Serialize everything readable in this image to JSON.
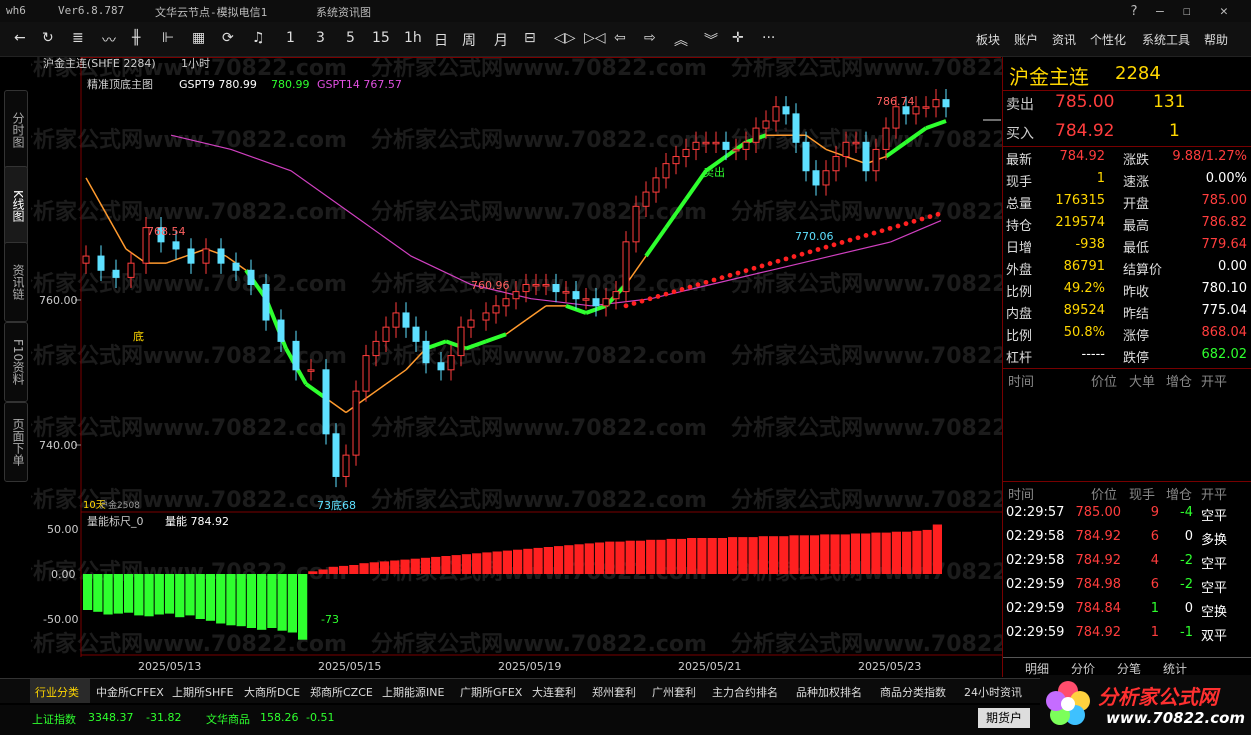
{
  "titlebar": {
    "app": "wh6",
    "version": "Ver6.8.787",
    "node": "文华云节点-模拟电信1",
    "news": "系统资讯图"
  },
  "toolbar": {
    "periods": [
      "1",
      "3",
      "5",
      "15",
      "1h",
      "日",
      "周",
      "月"
    ],
    "menus": [
      "板块",
      "账户",
      "资讯",
      "个性化",
      "系统工具",
      "帮助"
    ]
  },
  "left_tabs": [
    "分时图",
    "K线图",
    "资讯链",
    "F10资料",
    "页面下单"
  ],
  "chart": {
    "contract_label": "沪金主连(SHFE 2284)",
    "period": "1小时",
    "indicator_name": "精准顶底主图",
    "gsp9_label": "GSPT9 780.99",
    "gsp9_val": "780.99",
    "gsp14_label": "GSPT14 767.57",
    "price_ticks": [
      "760.00",
      "740.00"
    ],
    "annotations": {
      "high1": "768.54",
      "bottom1": "底",
      "high2": "760.96",
      "low_point": "73底68",
      "sell": "卖出",
      "low2": "770.06",
      "high3": "786.74",
      "days": "10天",
      "contract_code": "沪金2508"
    },
    "sub_indicator": "量能标尺_0",
    "sub_value": "量能 784.92",
    "sub_ticks": [
      "50.00",
      "0.00",
      "-50.00"
    ],
    "sub_min_label": "-73",
    "dates": [
      "2025/05/13",
      "2025/05/15",
      "2025/05/19",
      "2025/05/21",
      "2025/05/23"
    ],
    "watermark": "分析家公式网www.70822.com"
  },
  "chart_data": {
    "type": "candlestick",
    "title": "沪金主连(SHFE 2284)",
    "ylim": [
      728,
      792
    ],
    "volume_series": [
      -40,
      -42,
      -45,
      -44,
      -43,
      -46,
      -47,
      -45,
      -44,
      -48,
      -46,
      -50,
      -52,
      -55,
      -57,
      -58,
      -60,
      -62,
      -60,
      -63,
      -65,
      -73,
      3,
      5,
      8,
      9,
      10,
      12,
      13,
      14,
      15,
      16,
      17,
      18,
      19,
      20,
      21,
      22,
      23,
      24,
      25,
      26,
      27,
      28,
      29,
      30,
      31,
      32,
      33,
      34,
      35,
      36,
      36,
      37,
      37,
      38,
      38,
      39,
      39,
      40,
      40,
      40,
      40,
      41,
      41,
      41,
      42,
      42,
      42,
      43,
      43,
      43,
      44,
      44,
      44,
      45,
      45,
      46,
      46,
      47,
      47,
      48,
      49,
      55
    ]
  },
  "quote": {
    "name": "沪金主连",
    "code": "2284",
    "sell_label": "卖出",
    "sell_price": "785.00",
    "sell_qty": "131",
    "buy_label": "买入",
    "buy_price": "784.92",
    "buy_qty": "1",
    "rows": [
      [
        "最新",
        "784.92",
        "涨跌",
        "9.88/1.27%"
      ],
      [
        "现手",
        "1",
        "速涨",
        "0.00%"
      ],
      [
        "总量",
        "176315",
        "开盘",
        "785.00"
      ],
      [
        "持仓",
        "219574",
        "最高",
        "786.82"
      ],
      [
        "日增",
        "-938",
        "最低",
        "779.64"
      ],
      [
        "外盘",
        "86791",
        "结算价",
        "0.00"
      ],
      [
        "比例",
        "49.2%",
        "昨收",
        "780.10"
      ],
      [
        "内盘",
        "89524",
        "昨结",
        "775.04"
      ],
      [
        "比例",
        "50.8%",
        "涨停",
        "868.04"
      ],
      [
        "杠杆",
        "-----",
        "跌停",
        "682.02"
      ]
    ],
    "tick_header1": [
      "时间",
      "价位",
      "大单",
      "增仓",
      "开平"
    ],
    "tick_header2": [
      "时间",
      "价位",
      "现手",
      "增仓",
      "开平"
    ],
    "ticks": [
      [
        "02:29:57",
        "785.00",
        "9",
        "-4",
        "空平"
      ],
      [
        "02:29:58",
        "784.92",
        "6",
        "0",
        "多换"
      ],
      [
        "02:29:58",
        "784.92",
        "4",
        "-2",
        "空平"
      ],
      [
        "02:29:59",
        "784.98",
        "6",
        "-2",
        "空平"
      ],
      [
        "02:29:59",
        "784.84",
        "1",
        "0",
        "空换"
      ],
      [
        "02:29:59",
        "784.92",
        "1",
        "-1",
        "双平"
      ]
    ],
    "bottom_tabs": [
      "明细",
      "分价",
      "分笔",
      "统计"
    ]
  },
  "bottombar": {
    "items": [
      "行业分类",
      "中金所CFFEX",
      "上期所SHFE",
      "大商所DCE",
      "郑商所CZCE",
      "上期能源INE",
      "广期所GFEX",
      "大连套利",
      "郑州套利",
      "广州套利",
      "主力合约排名",
      "品种加权排名",
      "商品分类指数",
      "24小时资讯"
    ]
  },
  "statusbar": {
    "index1": "上证指数",
    "index1_val": "3348.37",
    "index1_chg": "-31.82",
    "index2": "文华商品",
    "index2_val": "158.26",
    "index2_chg": "-0.51",
    "button": "期货户",
    "logo_text": "分析家公式网",
    "logo_url": "www.70822.com"
  }
}
